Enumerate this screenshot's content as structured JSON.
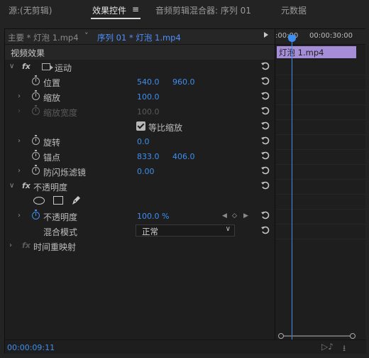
{
  "tabs": {
    "source": "源:(无剪辑)",
    "effect_controls": "效果控件",
    "menu_glyph": "≡",
    "audio_mixer": "音频剪辑混合器: 序列 01",
    "metadata": "元数据"
  },
  "header": {
    "source_clip": "主要 * 灯泡 1.mp4",
    "chevron": "˅",
    "sequence_clip": "序列 01 * 灯泡 1.mp4"
  },
  "timeline": {
    "start_time": ":00:00",
    "end_time": "00:00:30:00",
    "clip_name": "灯泡 1.mp4"
  },
  "effects": {
    "video_effects": "视频效果",
    "motion": {
      "fx": "fx",
      "name": "运动",
      "position_label": "位置",
      "position_x": "540.0",
      "position_y": "960.0",
      "scale_label": "缩放",
      "scale_value": "100.0",
      "scale_width_label": "缩放宽度",
      "scale_width_value": "100.0",
      "uniform_scale_label": "等比缩放",
      "rotation_label": "旋转",
      "rotation_value": "0.0",
      "anchor_label": "锚点",
      "anchor_x": "833.0",
      "anchor_y": "406.0",
      "anti_flicker_label": "防闪烁滤镜",
      "anti_flicker_value": "0.00"
    },
    "opacity": {
      "fx": "fx",
      "name": "不透明度",
      "opacity_label": "不透明度",
      "opacity_value": "100.0 %",
      "blend_label": "混合模式",
      "blend_value": "正常"
    },
    "time_remap": {
      "fx": "fx",
      "name": "时间重映射"
    }
  },
  "footer": {
    "timecode": "00:00:09:11"
  },
  "colors": {
    "accent": "#3f8ff0",
    "clip": "#a58ed7",
    "background": "#1e1e1e"
  }
}
